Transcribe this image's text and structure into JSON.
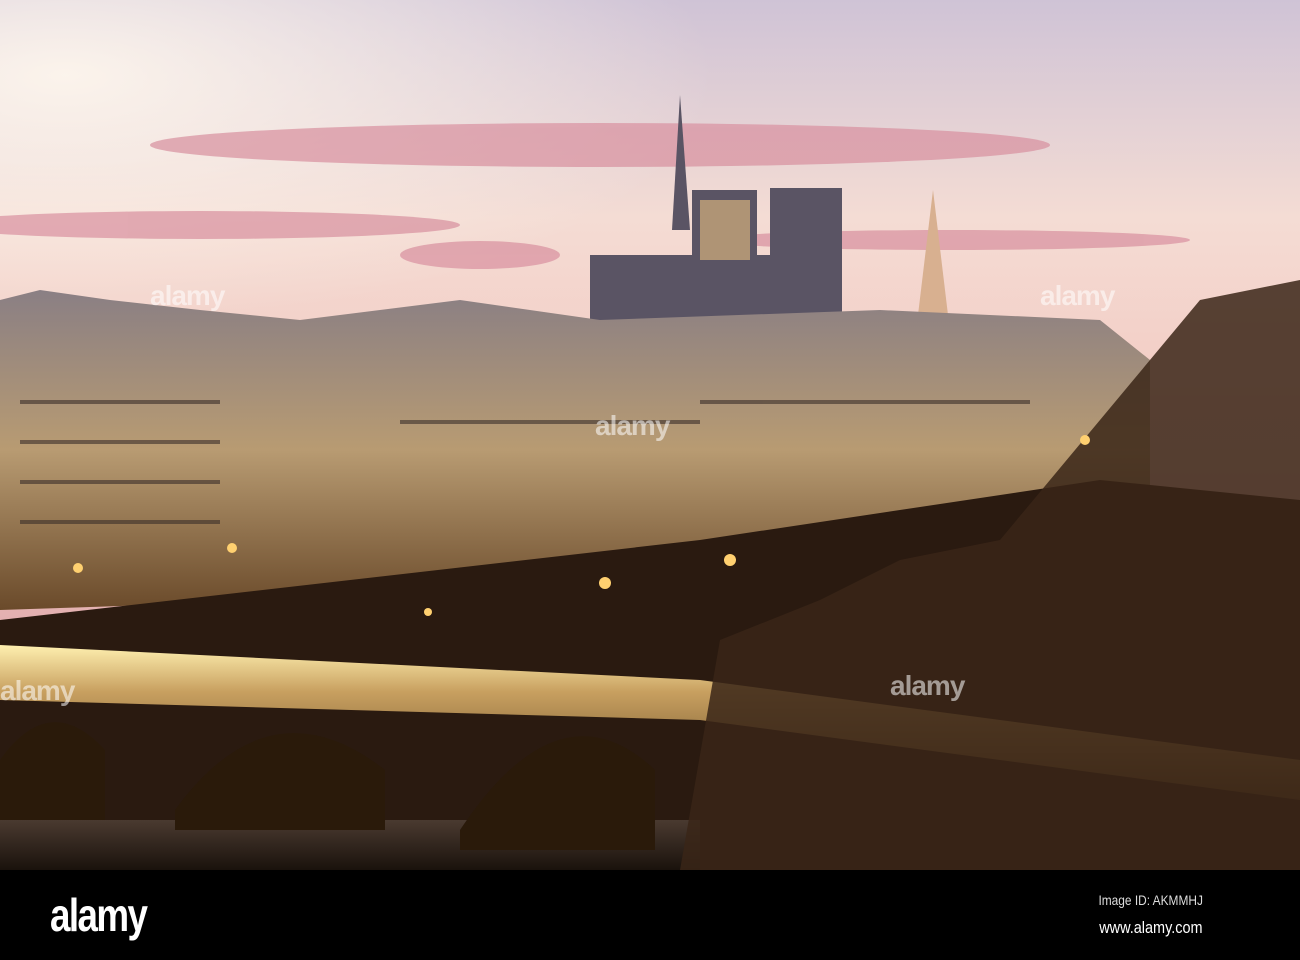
{
  "watermark": "alamy",
  "footer": {
    "logo": "alamy",
    "image_id": "Image ID: AKMMHJ",
    "website": "www.alamy.com"
  },
  "colors": {
    "sky_top": "#c9b8c8",
    "sky_glow": "#f6dcd0",
    "cloud_pink": "#d98e9e",
    "buildings": "#a08a6e",
    "lamp": "#ffc860",
    "footer_bg": "#000000"
  }
}
